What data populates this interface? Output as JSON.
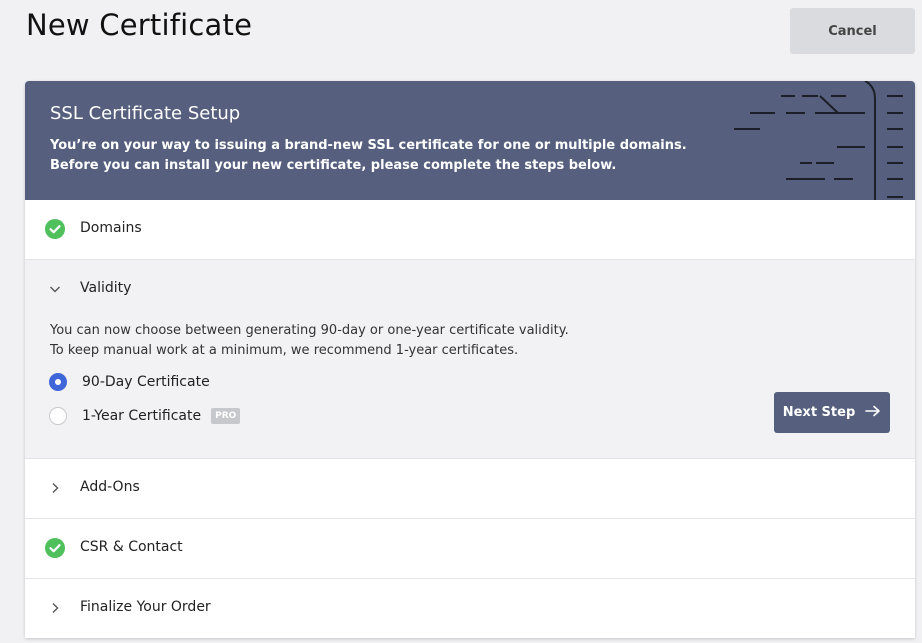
{
  "header": {
    "title": "New Certificate",
    "cancel_label": "Cancel"
  },
  "banner": {
    "title": "SSL Certificate Setup",
    "line1": "You’re on your way to issuing a brand-new SSL certificate for one or multiple domains.",
    "line2": "Before you can install your new certificate, please complete the steps below."
  },
  "steps": [
    {
      "label": "Domains",
      "state": "complete",
      "icon": "check-circle-icon"
    },
    {
      "label": "Validity",
      "state": "expanded",
      "icon": "chevron-down-icon"
    },
    {
      "label": "Add-Ons",
      "state": "collapsed",
      "icon": "chevron-right-icon"
    },
    {
      "label": "CSR & Contact",
      "state": "complete",
      "icon": "check-circle-icon"
    },
    {
      "label": "Finalize Your Order",
      "state": "collapsed",
      "icon": "chevron-right-icon"
    }
  ],
  "validity": {
    "desc1": "You can now choose between generating 90-day or one-year certificate validity.",
    "desc2": "To keep manual work at a minimum, we recommend 1-year certificates.",
    "options": [
      {
        "label": "90-Day Certificate",
        "selected": true
      },
      {
        "label": "1-Year Certificate",
        "selected": false,
        "badge": "PRO"
      }
    ],
    "next_label": "Next Step"
  },
  "colors": {
    "accent": "#56607e",
    "radio_selected": "#3f66d8",
    "success": "#4fc05c",
    "badge": "#c7c8cc"
  }
}
